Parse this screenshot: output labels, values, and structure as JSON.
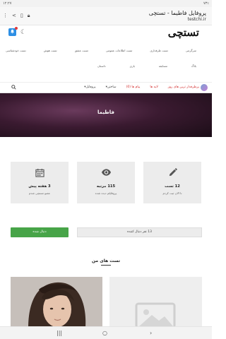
{
  "status": {
    "time": "۱۲:۲۷",
    "carrier_left": "۱۹",
    "battery": "۷۳٪"
  },
  "browser": {
    "page_title": "پروفایل فاطیما - تستچی",
    "domain": "testchi.ir"
  },
  "site": {
    "logo": "تستچی",
    "categories_row1": [
      "تست خودشناسی",
      "تست هوش",
      "تست عشق",
      "تست اطلاعات عمومی",
      "تست طرفداری",
      "سرگرمی"
    ],
    "categories_row2": [
      "داستان",
      "بازی",
      "مسابقه",
      "بلاگ"
    ]
  },
  "nav": {
    "items": [
      {
        "label": "پروفایل",
        "style": "plain",
        "has_caret": true
      },
      {
        "label": "ساختن",
        "style": "plain",
        "has_caret": true
      },
      {
        "label": "پیام ها (0)",
        "style": "red"
      },
      {
        "label": "لایه ها",
        "style": "red"
      },
      {
        "label": "پرطرفدار ترین های روز",
        "style": "red"
      }
    ],
    "caret": "▾"
  },
  "profile": {
    "name": "فاطیما"
  },
  "stats": [
    {
      "value": "3 هفته پیش",
      "desc": "عضو تستچی شدم",
      "icon": "calendar-icon"
    },
    {
      "value": "115 مرتبه",
      "desc": "پروفایلم دیده شده",
      "icon": "eye-icon"
    },
    {
      "value": "12 تست",
      "desc": "تا الان ثبت کردم",
      "icon": "pencil-icon"
    }
  ],
  "follow": {
    "following_text": "13 نفر دنبال کننده",
    "button_label": "دنبال شده",
    "button_color": "#47a448"
  },
  "tests_section": {
    "title": "تست های من"
  },
  "colors": {
    "accent_red": "#d22a2a",
    "bell_blue": "#2d8fe4"
  }
}
